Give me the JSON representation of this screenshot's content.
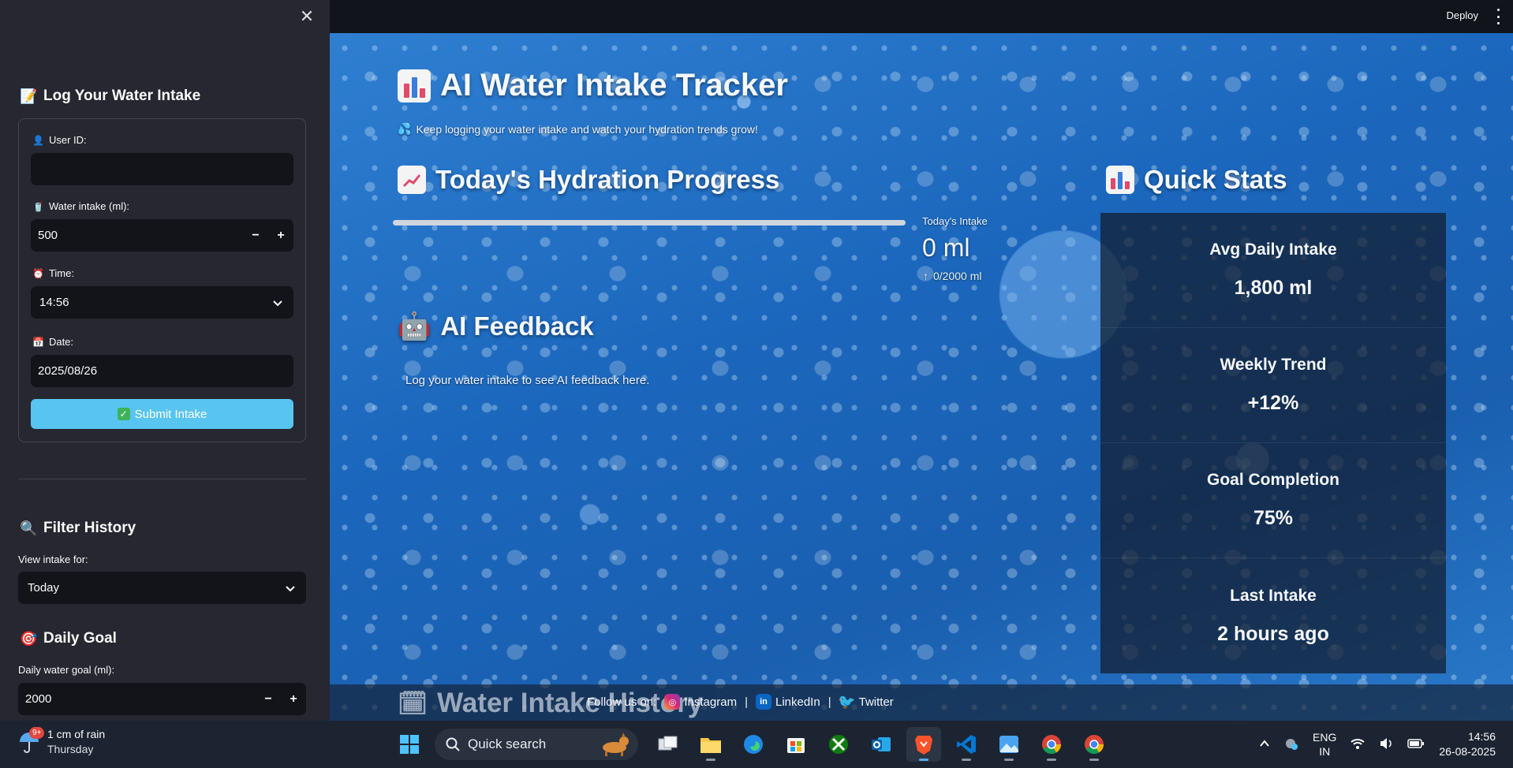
{
  "sidebar": {
    "close_icon": "close-icon",
    "log_section": {
      "title": "Log Your Water Intake",
      "icon": "memo-icon",
      "user_id": {
        "label": "User ID:",
        "value": ""
      },
      "water_intake": {
        "label": "Water intake (ml):",
        "value": "500",
        "minus": "−",
        "plus": "+"
      },
      "time": {
        "label": "Time:",
        "value": "14:56"
      },
      "date": {
        "label": "Date:",
        "value": "2025/08/26"
      },
      "submit_label": "Submit Intake"
    },
    "filter_section": {
      "title": "Filter History",
      "label": "View intake for:",
      "selected": "Today"
    },
    "goal_section": {
      "title": "Daily Goal",
      "label": "Daily water goal (ml):",
      "value": "2000",
      "minus": "−",
      "plus": "+"
    }
  },
  "topbar": {
    "deploy_label": "Deploy"
  },
  "main": {
    "title": "AI Water Intake Tracker",
    "caption": "Keep logging your water intake and watch your hydration trends grow!",
    "progress": {
      "title": "Today's Hydration Progress",
      "fraction": 0,
      "metric_label": "Today's Intake",
      "metric_value": "0 ml",
      "metric_delta": "0/2000 ml"
    },
    "feedback": {
      "title": "AI Feedback",
      "text": "Log your water intake to see AI feedback here."
    },
    "quick_stats": {
      "title": "Quick Stats",
      "cards": [
        {
          "title": "Avg Daily Intake",
          "value": "1,800 ml"
        },
        {
          "title": "Weekly Trend",
          "value": "+12%"
        },
        {
          "title": "Goal Completion",
          "value": "75%"
        },
        {
          "title": "Last Intake",
          "value": "2 hours ago"
        }
      ]
    },
    "history_title": "Water Intake History",
    "footer": {
      "follow": "Follow us on:",
      "links": [
        "Instagram",
        "LinkedIn",
        "Twitter"
      ],
      "separator": "|"
    }
  },
  "taskbar": {
    "weather_text": "1 cm of rain",
    "weather_day": "Thursday",
    "weather_badge": "9+",
    "search_placeholder": "Quick search",
    "lang_top": "ENG",
    "lang_bottom": "IN",
    "time": "14:56",
    "date": "26-08-2025"
  },
  "colors": {
    "sidebar_bg": "#262730",
    "submit_bg": "#58c4f0",
    "progress_fill": "#1aa0a8",
    "stats_card_bg": "#121c2c"
  }
}
